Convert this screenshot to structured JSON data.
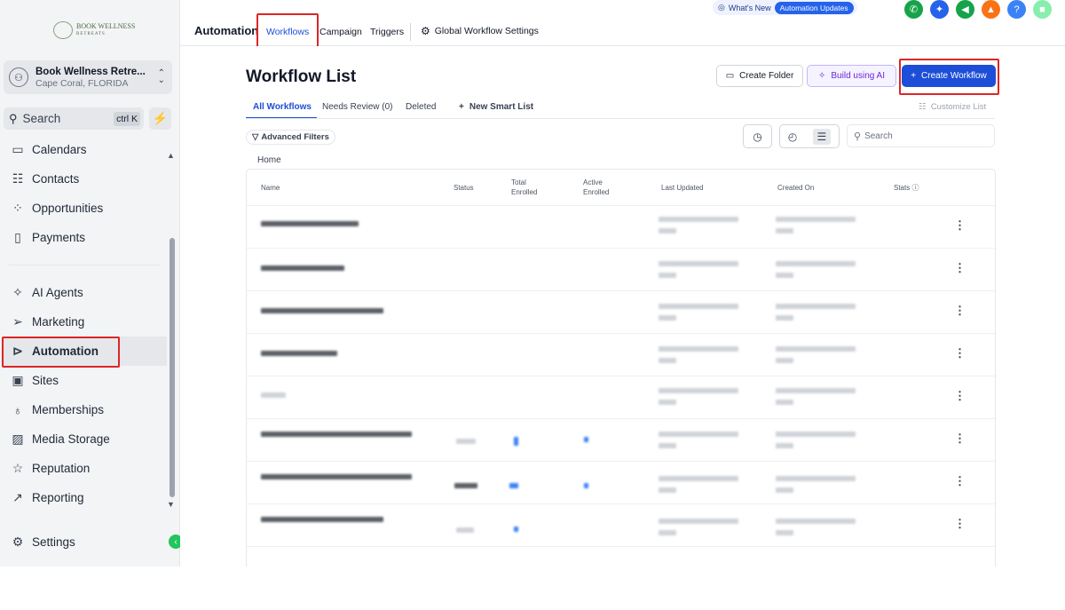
{
  "brand": {
    "logo_text": "BOOK WELLNESS",
    "logo_sub": "RETREATS"
  },
  "account": {
    "name": "Book Wellness Retre...",
    "location": "Cape Coral, FLORIDA"
  },
  "sidebar_search": {
    "label": "Search",
    "shortcut": "ctrl K"
  },
  "sidebar": {
    "items": [
      {
        "label": "Calendars",
        "icon": "calendar-icon",
        "glyph": "▭"
      },
      {
        "label": "Contacts",
        "icon": "contacts-icon",
        "glyph": "☷"
      },
      {
        "label": "Opportunities",
        "icon": "opportunities-icon",
        "glyph": "⁘"
      },
      {
        "label": "Payments",
        "icon": "payments-icon",
        "glyph": "▯"
      },
      {
        "label": "AI Agents",
        "icon": "ai-agents-icon",
        "glyph": "✧"
      },
      {
        "label": "Marketing",
        "icon": "marketing-icon",
        "glyph": "➢"
      },
      {
        "label": "Automation",
        "icon": "automation-icon",
        "glyph": "⊳"
      },
      {
        "label": "Sites",
        "icon": "sites-icon",
        "glyph": "▣"
      },
      {
        "label": "Memberships",
        "icon": "memberships-icon",
        "glyph": "♁"
      },
      {
        "label": "Media Storage",
        "icon": "media-storage-icon",
        "glyph": "▨"
      },
      {
        "label": "Reputation",
        "icon": "reputation-icon",
        "glyph": "☆"
      },
      {
        "label": "Reporting",
        "icon": "reporting-icon",
        "glyph": "↗"
      }
    ],
    "settings": {
      "label": "Settings",
      "icon": "settings-icon",
      "glyph": "⚙"
    }
  },
  "topbar": {
    "title": "Automation",
    "tabs": [
      "Workflows",
      "Campaign",
      "Triggers"
    ],
    "global_settings": "Global Workflow Settings",
    "whats_new": "What's New",
    "updates_pill": "Automation Updates",
    "icons": [
      {
        "name": "phone-icon",
        "color": "#16a34a",
        "glyph": "✆"
      },
      {
        "name": "sparkle-icon",
        "color": "#2563eb",
        "glyph": "✦"
      },
      {
        "name": "megaphone-icon",
        "color": "#16a34a",
        "glyph": "◀"
      },
      {
        "name": "bell-icon",
        "color": "#f97316",
        "glyph": "▲"
      },
      {
        "name": "help-icon",
        "color": "#3b82f6",
        "glyph": "?"
      },
      {
        "name": "video-icon",
        "color": "#86efac",
        "glyph": "■"
      }
    ]
  },
  "main": {
    "title": "Workflow List",
    "buttons": {
      "create_folder": "Create Folder",
      "build_ai": "Build using AI",
      "create_workflow": "Create Workflow"
    },
    "sub_tabs": [
      "All Workflows",
      "Needs Review (0)",
      "Deleted"
    ],
    "new_smart_list": "New Smart List",
    "customize_list": "Customize List",
    "advanced_filters": "Advanced Filters",
    "search_placeholder": "Search",
    "breadcrumb": "Home"
  },
  "table": {
    "columns": [
      "Name",
      "Status",
      "Total Enrolled",
      "Active Enrolled",
      "Last Updated",
      "Created On",
      "Stats"
    ]
  },
  "colors": {
    "accent": "#1d4ed8",
    "highlight": "#dc2626",
    "ai": "#6d28d9"
  }
}
